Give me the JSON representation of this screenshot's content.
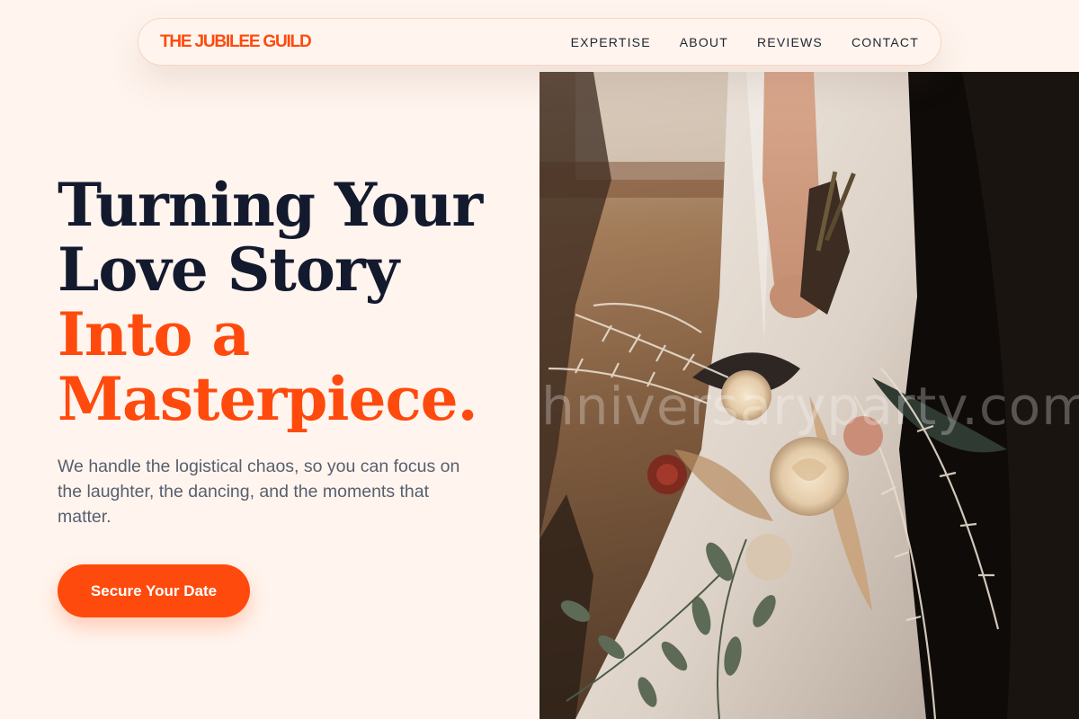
{
  "nav": {
    "brand": "THE JUBILEE GUILD",
    "links": [
      {
        "label": "EXPERTISE"
      },
      {
        "label": "ABOUT"
      },
      {
        "label": "REVIEWS"
      },
      {
        "label": "CONTACT"
      }
    ]
  },
  "hero": {
    "title_lines": [
      "Turning Your",
      "Love Story"
    ],
    "title_accent_lines": [
      "Into a",
      "Masterpiece."
    ],
    "subtitle": "We handle the logistical chaos, so you can focus on the laughter, the dancing, and the moments that matter.",
    "cta_label": "Secure Your Date",
    "image": {
      "subject": "bride holding dried flower bouquet",
      "watermark": "hniversaryparty.com"
    }
  },
  "colors": {
    "accent": "#ff4a0d",
    "background": "#fff5ee",
    "heading": "#141a2e",
    "body_text": "#585e6e"
  }
}
